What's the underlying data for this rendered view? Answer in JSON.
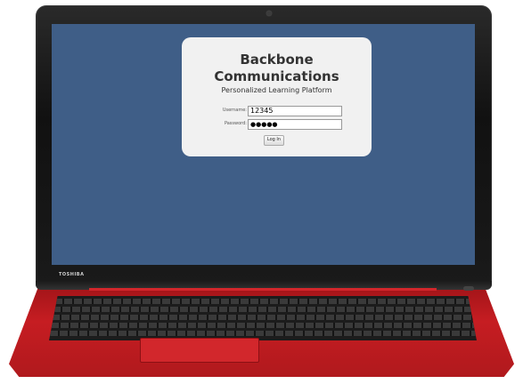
{
  "login": {
    "title_line1": "Backbone",
    "title_line2": "Communications",
    "subtitle": "Personalized Learning Platform",
    "username_label": "Username:",
    "username_value": "12345",
    "password_label": "Password:",
    "password_value": "●●●●●",
    "login_button": "Log In"
  },
  "device": {
    "brand": "TOSHIBA"
  },
  "colors": {
    "screen_background": "#3f5e87",
    "card_background": "#f1f1f1",
    "laptop_body": "#c61d22"
  }
}
